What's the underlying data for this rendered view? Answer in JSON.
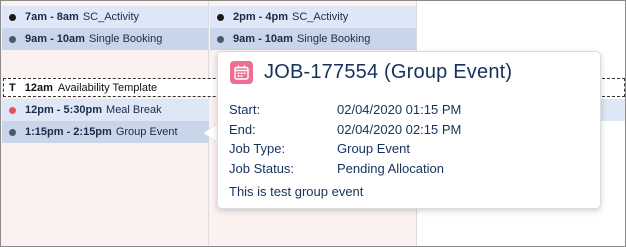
{
  "columns": [
    {
      "events": [
        {
          "time": "7am - 8am",
          "title": "SC_Activity",
          "dot_color": "#1a1a1a"
        },
        {
          "time": "9am - 10am",
          "title": "Single Booking",
          "dot_color": "#4a5670"
        },
        {
          "time": "12pm - 5:30pm",
          "title": "Meal Break",
          "dot_color": "#e4545e"
        },
        {
          "time": "1:15pm - 2:15pm",
          "title": "Group Event",
          "dot_color": "#4a5670"
        }
      ]
    },
    {
      "events": [
        {
          "time": "2pm - 4pm",
          "title": "SC_Activity",
          "dot_color": "#1a1a1a"
        },
        {
          "time": "9am - 10am",
          "title": "Single Booking",
          "dot_color": "#4a5670"
        }
      ]
    }
  ],
  "availability": {
    "type_char": "T",
    "time": "12am",
    "title": "Availability Template"
  },
  "popover": {
    "icon": "calendar-icon",
    "icon_color": "#eb7092",
    "title": "JOB-177554 (Group Event)",
    "fields": [
      {
        "label": "Start:",
        "value": "02/04/2020 01:15 PM"
      },
      {
        "label": "End:",
        "value": "02/04/2020 02:15 PM"
      },
      {
        "label": "Job Type:",
        "value": "Group Event"
      },
      {
        "label": "Job Status:",
        "value": "Pending Allocation"
      }
    ],
    "description": "This is test group event"
  }
}
